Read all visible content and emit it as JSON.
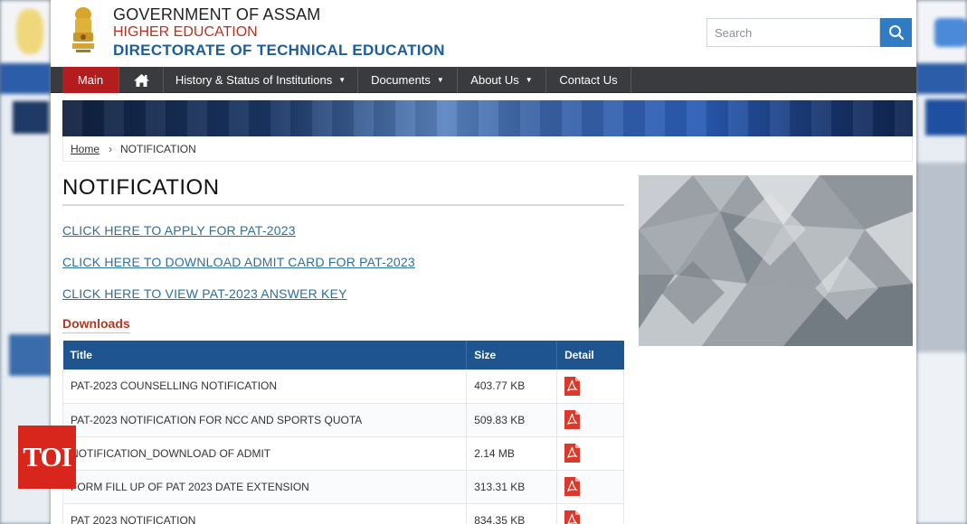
{
  "header": {
    "line1": "GOVERNMENT OF ASSAM",
    "line2": "HIGHER EDUCATION",
    "line3": "DIRECTORATE OF TECHNICAL EDUCATION",
    "emblem_icon": "state-emblem-icon"
  },
  "search": {
    "placeholder": "Search",
    "icon": "search-icon"
  },
  "nav": {
    "items": [
      {
        "label": "Main",
        "active": true
      },
      {
        "label": "",
        "icon": "home-icon"
      },
      {
        "label": "History & Status of Institutions",
        "dropdown": true
      },
      {
        "label": "Documents",
        "dropdown": true
      },
      {
        "label": "About Us",
        "dropdown": true
      },
      {
        "label": "Contact Us"
      }
    ]
  },
  "breadcrumb": {
    "home": "Home",
    "current": "NOTIFICATION"
  },
  "main": {
    "title": "NOTIFICATION",
    "links": [
      "CLICK HERE TO APPLY FOR PAT-2023",
      "CLICK HERE TO DOWNLOAD ADMIT CARD FOR PAT-2023",
      "CLICK HERE TO VIEW PAT-2023 ANSWER KEY"
    ],
    "downloads_heading": "Downloads",
    "table": {
      "headers": [
        "Title",
        "Size",
        "Detail"
      ],
      "rows": [
        {
          "title": "PAT-2023 COUNSELLING NOTIFICATION",
          "size": "403.77 KB",
          "detail_icon": "pdf-icon"
        },
        {
          "title": "PAT-2023 NOTIFICATION FOR NCC AND SPORTS QUOTA",
          "size": "509.83 KB",
          "detail_icon": "pdf-icon"
        },
        {
          "title": "NOTIFICATION_DOWNLOAD OF ADMIT",
          "size": "2.14 MB",
          "detail_icon": "pdf-icon"
        },
        {
          "title": "FORM FILL UP OF PAT 2023 DATE EXTENSION",
          "size": "313.31 KB",
          "detail_icon": "pdf-icon"
        },
        {
          "title": "PAT 2023 NOTIFICATION",
          "size": "834.35 KB",
          "detail_icon": "pdf-icon"
        }
      ]
    }
  },
  "watermark": {
    "text": "TOI"
  },
  "colors": {
    "nav_bg": "#3a3b3e",
    "nav_active": "#b31d1d",
    "table_header": "#1e5590",
    "link": "#2d6f9f",
    "downloads_heading": "#b13a26",
    "brand_red": "#b8321f",
    "brand_blue": "#1e5d9a",
    "search_button": "#2f7cc4",
    "toi_red": "#d9261c"
  }
}
